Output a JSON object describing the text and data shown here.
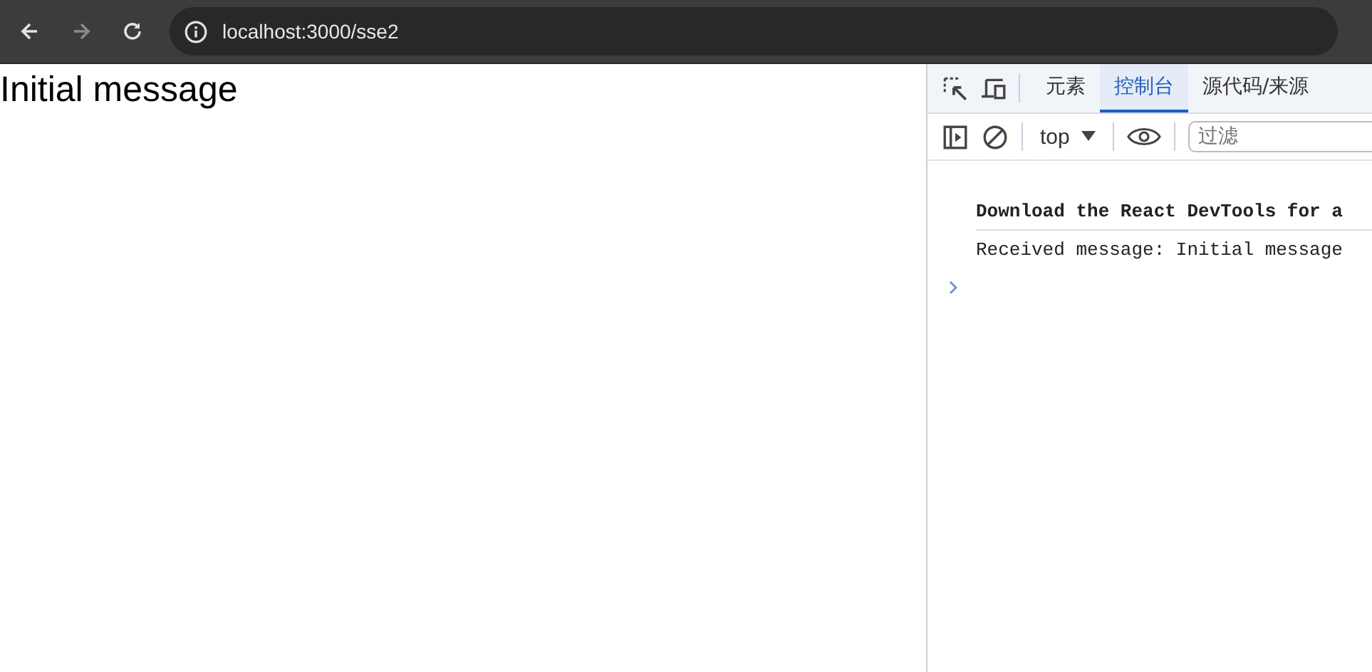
{
  "browser": {
    "url": "localhost:3000/sse2"
  },
  "page": {
    "heading": "Initial message"
  },
  "devtools": {
    "tabs": [
      {
        "label": "元素",
        "selected": false
      },
      {
        "label": "控制台",
        "selected": true
      },
      {
        "label": "源代码/来源",
        "selected": false
      }
    ],
    "context": "top",
    "filter": {
      "placeholder": "过滤"
    },
    "messages": [
      {
        "text": "Download the React DevTools for a",
        "bold": true
      },
      {
        "text": "Received message: Initial message",
        "bold": false
      }
    ]
  }
}
